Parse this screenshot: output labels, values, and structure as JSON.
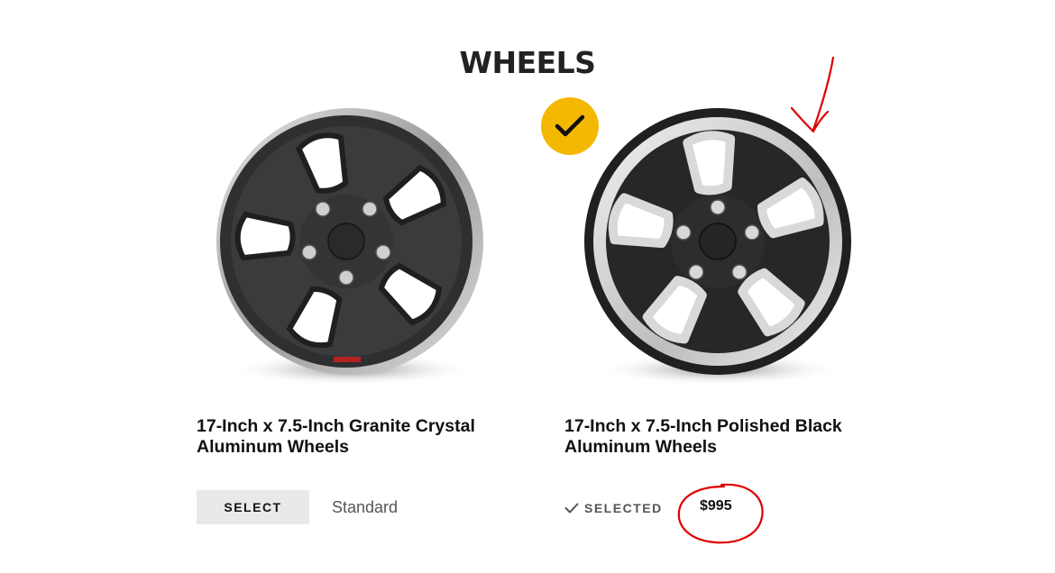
{
  "section": {
    "title": "WHEELS"
  },
  "wheels": [
    {
      "name": "17-Inch x 7.5-Inch Granite Crystal Aluminum Wheels",
      "button_label": "SELECT",
      "price": "Standard",
      "selected": false
    },
    {
      "name": "17-Inch x 7.5-Inch Polished Black Aluminum Wheels",
      "status_label": "SELECTED",
      "price": "$995",
      "selected": true
    }
  ],
  "icons": {
    "selected_badge": "check-icon",
    "status_check": "check-icon",
    "wheel_left": "granite-crystal-wheel-icon",
    "wheel_right": "polished-black-wheel-icon"
  },
  "colors": {
    "accent": "#f5b800",
    "button_bg": "#e9e9e9",
    "annotation": "#e00000"
  }
}
